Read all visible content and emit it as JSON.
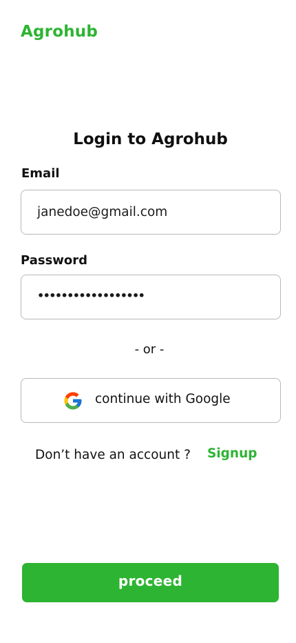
{
  "app": {
    "brand": "Agrohub"
  },
  "login": {
    "title": "Login to Agrohub",
    "email_label": "Email",
    "email_value": "janedoe@gmail.com",
    "password_label": "Password",
    "password_value": "••••••••••••••••••",
    "or_text": "- or -",
    "google_label": "continue with Google",
    "google_icon": "google-icon",
    "no_account_text": "Don’t have an account ?",
    "signup_label": "Signup",
    "proceed_label": "proceed"
  },
  "colors": {
    "brand_green": "#2db432",
    "border": "#b8b8b8",
    "text": "#111111",
    "background": "#ffffff"
  }
}
